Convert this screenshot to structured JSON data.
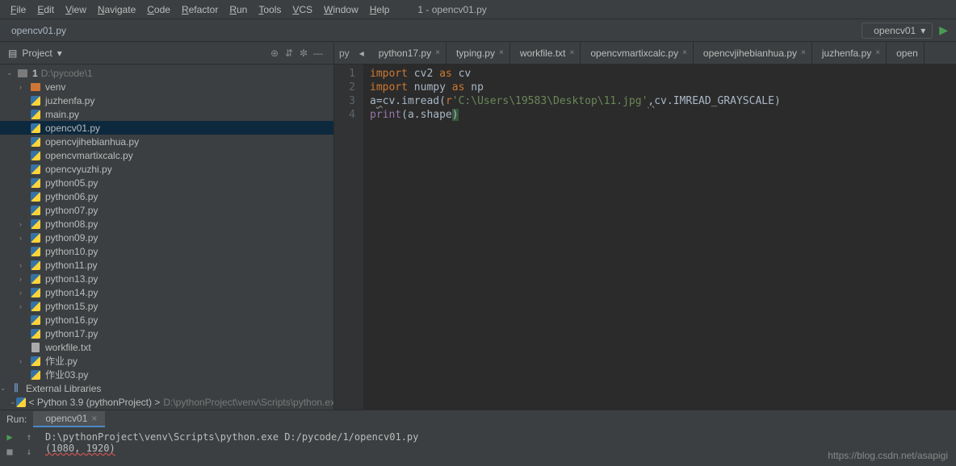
{
  "menu": [
    "File",
    "Edit",
    "View",
    "Navigate",
    "Code",
    "Refactor",
    "Run",
    "Tools",
    "VCS",
    "Window",
    "Help"
  ],
  "window_title": "1 - opencv01.py",
  "breadcrumb": "opencv01.py",
  "run_config": "opencv01",
  "sidebar": {
    "title": "Project",
    "project_root": {
      "name": "1",
      "path": "D:\\pycode\\1"
    },
    "tree": [
      {
        "t": "folder",
        "name": "venv",
        "depth": 1,
        "arrow": "›",
        "sel": false,
        "ico": "fold"
      },
      {
        "t": "py",
        "name": "juzhenfa.py",
        "depth": 1
      },
      {
        "t": "py",
        "name": "main.py",
        "depth": 1
      },
      {
        "t": "py",
        "name": "opencv01.py",
        "depth": 1,
        "sel": true
      },
      {
        "t": "py",
        "name": "opencvjihebianhua.py",
        "depth": 1
      },
      {
        "t": "py",
        "name": "opencvmartixcalc.py",
        "depth": 1
      },
      {
        "t": "py",
        "name": "opencvyuzhi.py",
        "depth": 1
      },
      {
        "t": "py",
        "name": "python05.py",
        "depth": 1
      },
      {
        "t": "py",
        "name": "python06.py",
        "depth": 1
      },
      {
        "t": "py",
        "name": "python07.py",
        "depth": 1
      },
      {
        "t": "py",
        "name": "python08.py",
        "depth": 1,
        "arrow": "›"
      },
      {
        "t": "py",
        "name": "python09.py",
        "depth": 1,
        "arrow": "›"
      },
      {
        "t": "py",
        "name": "python10.py",
        "depth": 1
      },
      {
        "t": "py",
        "name": "python11.py",
        "depth": 1,
        "arrow": "›"
      },
      {
        "t": "py",
        "name": "python13.py",
        "depth": 1,
        "arrow": "›"
      },
      {
        "t": "py",
        "name": "python14.py",
        "depth": 1,
        "arrow": "›"
      },
      {
        "t": "py",
        "name": "python15.py",
        "depth": 1,
        "arrow": "›"
      },
      {
        "t": "py",
        "name": "python16.py",
        "depth": 1
      },
      {
        "t": "py",
        "name": "python17.py",
        "depth": 1
      },
      {
        "t": "txt",
        "name": "workfile.txt",
        "depth": 1
      },
      {
        "t": "py",
        "name": "作业.py",
        "depth": 1,
        "arrow": "›"
      },
      {
        "t": "py",
        "name": "作业03.py",
        "depth": 1
      }
    ],
    "ext_lib": "External Libraries",
    "python_env": "< Python 3.9 (pythonProject) >",
    "python_env_path": "D:\\pythonProject\\venv\\Scripts\\python.exe"
  },
  "tabs": [
    {
      "name": "python17.py",
      "ico": "py"
    },
    {
      "name": "typing.py",
      "ico": "py"
    },
    {
      "name": "workfile.txt",
      "ico": "txt"
    },
    {
      "name": "opencvmartixcalc.py",
      "ico": "py"
    },
    {
      "name": "opencvjihebianhua.py",
      "ico": "py"
    },
    {
      "name": "juzhenfa.py",
      "ico": "py"
    },
    {
      "name": "open",
      "ico": "py",
      "noclose": true
    }
  ],
  "hidden_tab_label": "py",
  "code_lines": [
    "1",
    "2",
    "3",
    "4"
  ],
  "code": {
    "l1a": "import ",
    "l1b": "cv2 ",
    "l1c": "as ",
    "l1d": "cv",
    "l2a": "import ",
    "l2b": "numpy ",
    "l2c": "as ",
    "l2d": "np",
    "l3a": "a",
    "l3eq": "=",
    "l3b": "cv.imread(",
    "l3pr": "r",
    "l3c": "'C:\\Users\\19583\\Desktop\\11.jpg'",
    "l3cm": ",",
    "l3d": "cv.IMREAD_GRAYSCALE)",
    "l4a": "print",
    "l4b": "(",
    "l4c": "a.shape",
    "l4d": ")"
  },
  "run": {
    "label": "Run:",
    "tab": "opencv01",
    "out1": "D:\\pythonProject\\venv\\Scripts\\python.exe D:/pycode/1/opencv01.py",
    "out2": "(1080, 1920)"
  },
  "watermark": "https://blog.csdn.net/asapigi"
}
